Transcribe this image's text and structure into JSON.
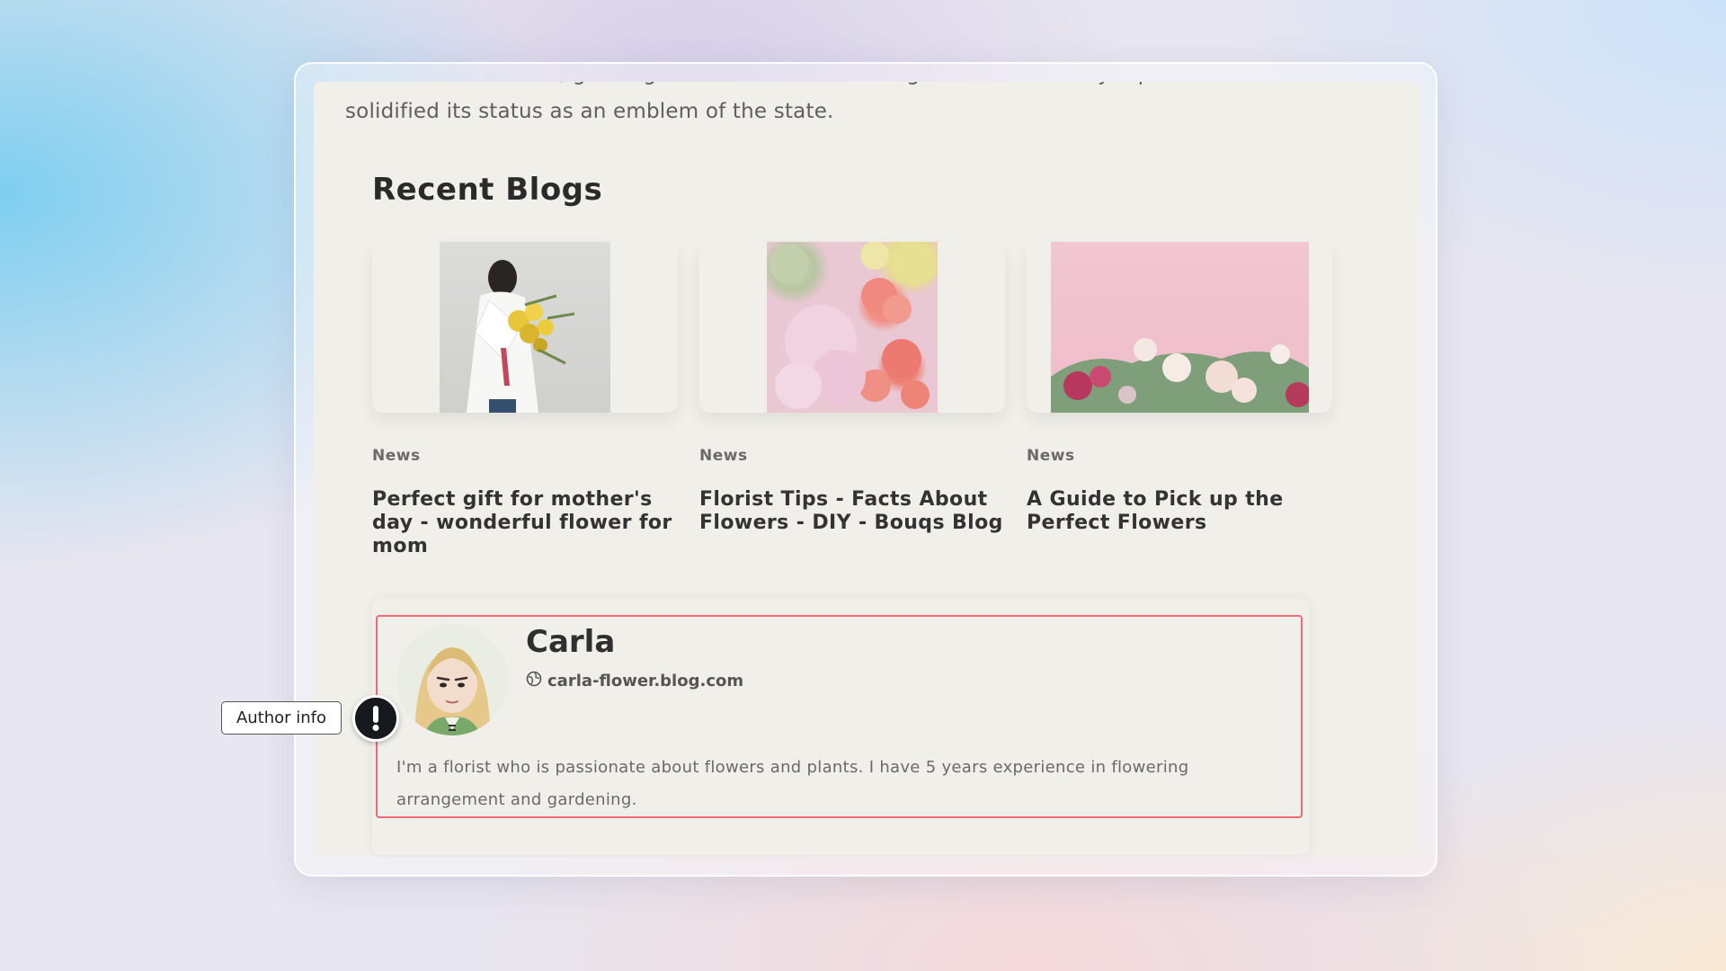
{
  "article": {
    "intro_line_1": "of the state of Idaho, growing at the feet of a female goddess. This early representation",
    "intro_line_2": "solidified its status as an emblem of the state."
  },
  "recent_blogs": {
    "title": "Recent Blogs",
    "posts": [
      {
        "tag": "News",
        "title": "Perfect gift for mother's day - wonderful flower for mom"
      },
      {
        "tag": "News",
        "title": "Florist Tips - Facts About Flowers - DIY - Bouqs Blog"
      },
      {
        "tag": "News",
        "title": "A Guide to Pick up the Perfect Flowers"
      }
    ]
  },
  "author": {
    "name": "Carla",
    "website": "carla-flower.blog.com",
    "bio": "I'm a florist who is passionate about flowers and plants. I have 5 years experience in flowering arrangement and gardening.",
    "website_icon": "globe-icon",
    "highlight_color": "#ee6b73"
  },
  "annotation": {
    "label": "Author info",
    "marker_icon": "exclamation-icon"
  }
}
